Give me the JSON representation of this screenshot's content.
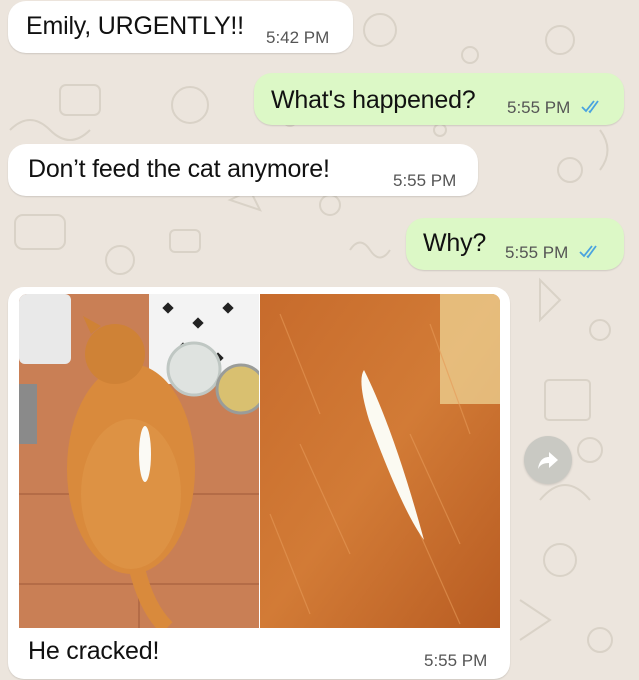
{
  "chat": {
    "messages": [
      {
        "direction": "incoming",
        "text": "Emily, URGENTLY!!",
        "time": "5:42 PM"
      },
      {
        "direction": "outgoing",
        "text": "What's happened?",
        "time": "5:55 PM",
        "status": "read"
      },
      {
        "direction": "incoming",
        "text": "Don’t feed the cat anymore!",
        "time": "5:55 PM"
      },
      {
        "direction": "outgoing",
        "text": "Why?",
        "time": "5:55 PM",
        "status": "read"
      },
      {
        "direction": "incoming",
        "type": "image",
        "caption": "He cracked!",
        "time": "5:55 PM",
        "images": [
          "orange-cat-from-above-photo",
          "cat-fur-white-streak-closeup-photo"
        ]
      }
    ]
  },
  "icons": {
    "forward": "forward-arrow-icon",
    "read_receipt": "double-check-icon"
  },
  "colors": {
    "background": "#ece5dd",
    "incoming_bubble": "#ffffff",
    "outgoing_bubble": "#dcf8c6",
    "read_tick": "#4aa3df"
  }
}
